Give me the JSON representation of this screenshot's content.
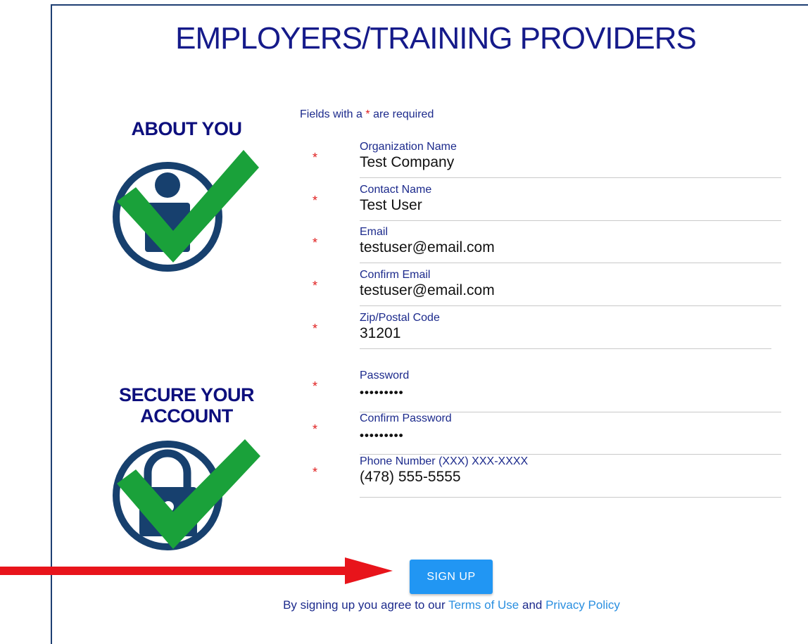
{
  "header": {
    "title": "EMPLOYERS/TRAINING PROVIDERS"
  },
  "sections": {
    "about": "ABOUT YOU",
    "secure_line1": "SECURE YOUR",
    "secure_line2": "ACCOUNT"
  },
  "form": {
    "required_note_prefix": "Fields with a",
    "required_star": "*",
    "required_note_suffix": "are required",
    "fields": [
      {
        "label": "Organization Name",
        "value": "Test Company"
      },
      {
        "label": "Contact Name",
        "value": "Test User"
      },
      {
        "label": "Email",
        "value": "testuser@email.com"
      },
      {
        "label": "Confirm Email",
        "value": "testuser@email.com"
      },
      {
        "label": "Zip/Postal Code",
        "value": "31201"
      },
      {
        "label": "Password",
        "value": "•••••••••"
      },
      {
        "label": "Confirm Password",
        "value": "•••••••••"
      },
      {
        "label": "Phone Number (XXX) XXX-XXXX",
        "value": "(478) 555-5555"
      }
    ],
    "submit_label": "SIGN UP"
  },
  "footer": {
    "agree_prefix": "By signing up you agree to our",
    "terms_link": "Terms of Use",
    "and": "and",
    "privacy_link": "Privacy Policy"
  },
  "icons": {
    "about": "person-check-icon",
    "secure": "lock-check-icon",
    "arrow": "red-arrow-icon"
  },
  "colors": {
    "title": "#151a8a",
    "heading": "#0d0f7d",
    "check_green": "#1aa13a",
    "circle_navy": "#17406e",
    "button": "#2196f3",
    "arrow_red": "#e8141b",
    "link": "#2a8fe0"
  }
}
